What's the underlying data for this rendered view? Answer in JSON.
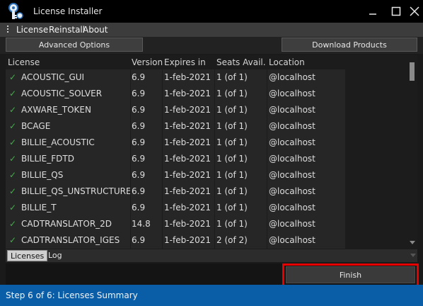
{
  "window": {
    "title": "License Installer"
  },
  "menu": {
    "items": [
      "License",
      "Reinstall",
      "About"
    ]
  },
  "toolbar": {
    "advanced_label": "Advanced Options",
    "download_label": "Download Products"
  },
  "table": {
    "headers": [
      "License",
      "Version",
      "Expires in",
      "Seats Avail.",
      "Location"
    ],
    "rows": [
      {
        "license": "ACOUSTIC_GUI",
        "version": "6.9",
        "expires": "1-feb-2021",
        "seats": "1 (of 1)",
        "location": "@localhost"
      },
      {
        "license": "ACOUSTIC_SOLVER",
        "version": "6.9",
        "expires": "1-feb-2021",
        "seats": "1 (of 1)",
        "location": "@localhost"
      },
      {
        "license": "AXWARE_TOKEN",
        "version": "6.9",
        "expires": "1-feb-2021",
        "seats": "1 (of 1)",
        "location": "@localhost"
      },
      {
        "license": "BCAGE",
        "version": "6.9",
        "expires": "1-feb-2021",
        "seats": "1 (of 1)",
        "location": "@localhost"
      },
      {
        "license": "BILLIE_ACOUSTIC",
        "version": "6.9",
        "expires": "1-feb-2021",
        "seats": "1 (of 1)",
        "location": "@localhost"
      },
      {
        "license": "BILLIE_FDTD",
        "version": "6.9",
        "expires": "1-feb-2021",
        "seats": "1 (of 1)",
        "location": "@localhost"
      },
      {
        "license": "BILLIE_QS",
        "version": "6.9",
        "expires": "1-feb-2021",
        "seats": "1 (of 1)",
        "location": "@localhost"
      },
      {
        "license": "BILLIE_QS_UNSTRUCTURED",
        "version": "6.9",
        "expires": "1-feb-2021",
        "seats": "1 (of 1)",
        "location": "@localhost"
      },
      {
        "license": "BILLIE_T",
        "version": "6.9",
        "expires": "1-feb-2021",
        "seats": "1 (of 1)",
        "location": "@localhost"
      },
      {
        "license": "CADTRANSLATOR_2D",
        "version": "14.8",
        "expires": "1-feb-2021",
        "seats": "1 (of 1)",
        "location": "@localhost"
      },
      {
        "license": "CADTRANSLATOR_IGES",
        "version": "6.9",
        "expires": "1-feb-2021",
        "seats": "2 (of 2)",
        "location": "@localhost"
      }
    ]
  },
  "tabs": [
    "Licenses",
    "Log"
  ],
  "finish_label": "Finish",
  "status": "Step 6 of 6: Licenses Summary",
  "colors": {
    "accent": "#0a5ea8",
    "check": "#3cb043",
    "highlight": "#e60000"
  },
  "icons": {
    "app": "key-lock-icon",
    "check": "check-icon"
  }
}
